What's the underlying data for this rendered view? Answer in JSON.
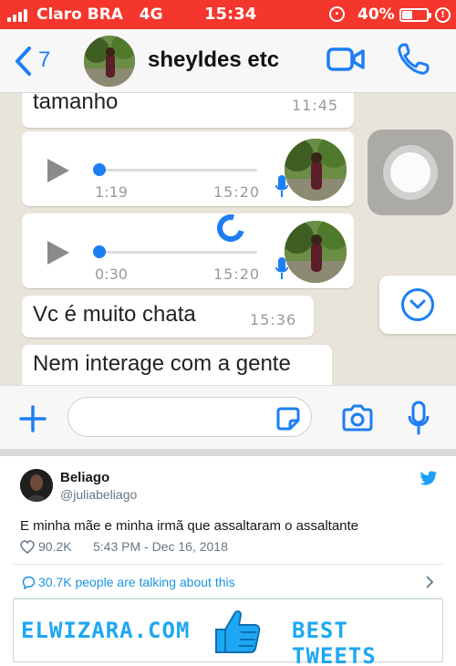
{
  "status_bar": {
    "carrier": "Claro BRA",
    "network": "4G",
    "time": "15:34",
    "battery_percent": "40%",
    "battery_level": 0.4,
    "background_color": "#f5362c"
  },
  "chat_header": {
    "back_count": "7",
    "contact_name": "sheyldes etc",
    "icons": [
      "chevron-left-icon",
      "video-icon",
      "phone-icon"
    ],
    "accent_color": "#1d7ef4"
  },
  "messages": [
    {
      "type": "text",
      "text": "tamanho",
      "time": "11:45"
    },
    {
      "type": "voice",
      "duration": "1:19",
      "time": "15:20"
    },
    {
      "type": "voice",
      "duration": "0:30",
      "time": "15:20"
    },
    {
      "type": "text",
      "text": "Vc é muito chata",
      "time": "15:36"
    },
    {
      "type": "text",
      "text": "Nem interage com a gente"
    }
  ],
  "compose": {
    "icons": [
      "plus-icon",
      "sticker-icon",
      "camera-icon",
      "mic-icon"
    ]
  },
  "tweet": {
    "name": "Beliago",
    "handle": "@juliabeliago",
    "text": "E minha mãe e minha irmã que assaltaram o assaltante",
    "likes": "90.2K",
    "date": "5:43 PM - Dec 16, 2018",
    "talking": "30.7K people are talking about this",
    "link_color": "#1b95e0"
  },
  "banner": {
    "site": "ELWIZARA.COM",
    "tagline": "BEST TWEETS",
    "color": "#1ea7f2"
  }
}
